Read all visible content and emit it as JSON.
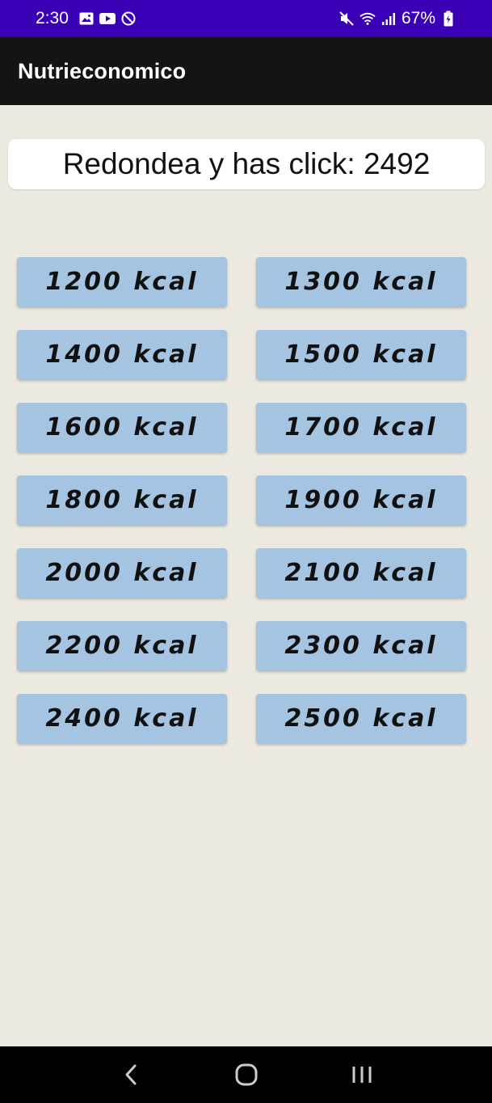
{
  "status_bar": {
    "time": "2:30",
    "battery": "67%",
    "left_icons": [
      "image-icon",
      "youtube-icon",
      "block-icon"
    ],
    "right_icons": [
      "mute-icon",
      "wifi-icon",
      "signal-icon",
      "battery-icon"
    ]
  },
  "app_bar": {
    "title": "Nutrieconomico"
  },
  "prompt": {
    "text": "Redondea y has click: 2492"
  },
  "options": [
    "1200 kcal",
    "1300 kcal",
    "1400 kcal",
    "1500 kcal",
    "1600 kcal",
    "1700 kcal",
    "1800 kcal",
    "1900 kcal",
    "2000 kcal",
    "2100 kcal",
    "2200 kcal",
    "2300 kcal",
    "2400 kcal",
    "2500 kcal"
  ],
  "nav_bar": {
    "buttons": [
      "back-icon",
      "home-icon",
      "recents-icon"
    ]
  },
  "colors": {
    "status_bar": "#3A00B5",
    "app_bar": "#141414",
    "background": "#ECEAE0",
    "button": "#A4C4E2"
  }
}
